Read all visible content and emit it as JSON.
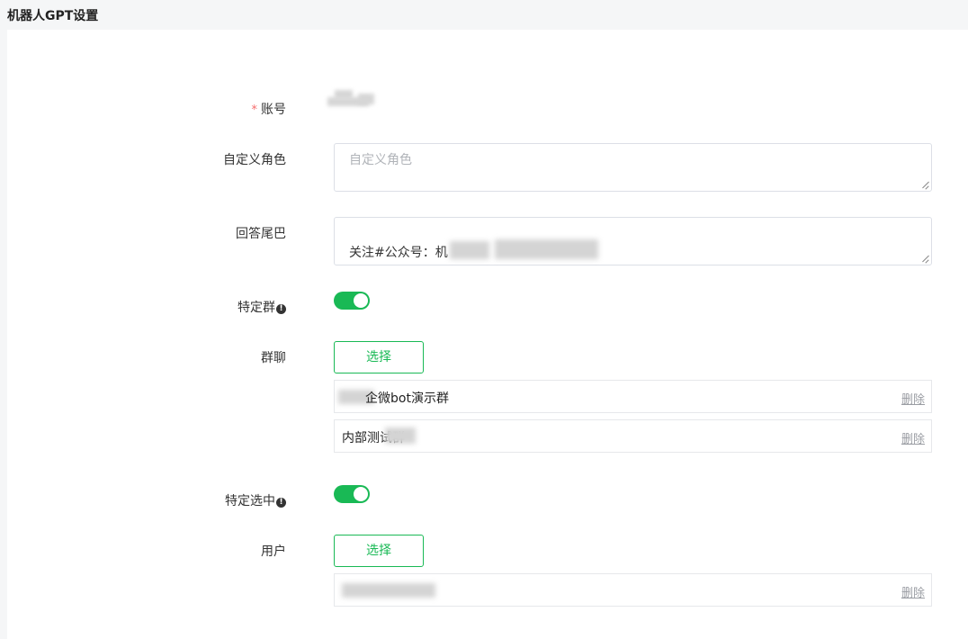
{
  "header": {
    "title": "机器人GPT设置"
  },
  "form": {
    "account": {
      "required_mark": "*",
      "label": "账号"
    },
    "custom_role": {
      "label": "自定义角色",
      "placeholder": "自定义角色",
      "value": ""
    },
    "answer_tail": {
      "label": "回答尾巴",
      "value": "关注#公众号：机"
    },
    "specific_group": {
      "label": "特定群",
      "info": "!",
      "enabled": true
    },
    "group_chat": {
      "label": "群聊",
      "select_label": "选择",
      "items": [
        {
          "name": "企微bot演示群",
          "delete_label": "删除"
        },
        {
          "name": "内部测试群",
          "delete_label": "删除"
        }
      ]
    },
    "specific_selected": {
      "label": "特定选中",
      "info": "!",
      "enabled": true
    },
    "users": {
      "label": "用户",
      "select_label": "选择",
      "items": [
        {
          "name": "",
          "delete_label": "删除"
        }
      ]
    }
  },
  "colors": {
    "accent": "#19b955",
    "required": "#f56c6c",
    "border": "#dcdfe6"
  }
}
